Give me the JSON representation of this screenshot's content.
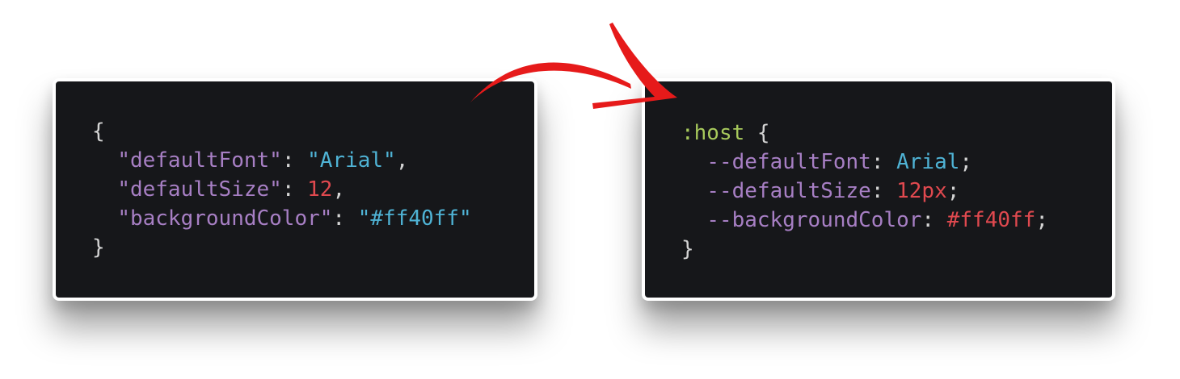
{
  "colors": {
    "background": "#ffffff",
    "panel": "#16171a",
    "punctuation": "#d4d4d4",
    "property": "#a77fc4",
    "string": "#4fb3d5",
    "number": "#e0494f",
    "selector": "#a7c95c",
    "arrow": "#e61a1a"
  },
  "left_code": {
    "open_brace": "{",
    "lines": [
      {
        "key": "\"defaultFont\"",
        "colon": ": ",
        "value": "\"Arial\"",
        "end": ","
      },
      {
        "key": "\"defaultSize\"",
        "colon": ": ",
        "value": "12",
        "end": ","
      },
      {
        "key": "\"backgroundColor\"",
        "colon": ": ",
        "value": "\"#ff40ff\"",
        "end": ""
      }
    ],
    "close_brace": "}"
  },
  "right_code": {
    "selector": ":host",
    "open_brace": " {",
    "lines": [
      {
        "prop": "--defaultFont",
        "colon": ": ",
        "value": "Arial",
        "end": ";"
      },
      {
        "prop": "--defaultSize",
        "colon": ": ",
        "value": "12px",
        "end": ";"
      },
      {
        "prop": "--backgroundColor",
        "colon": ": ",
        "value": "#ff40ff",
        "end": ";"
      }
    ],
    "close_brace": "}"
  },
  "arrow": {
    "icon": "curved-arrow-right-icon"
  }
}
